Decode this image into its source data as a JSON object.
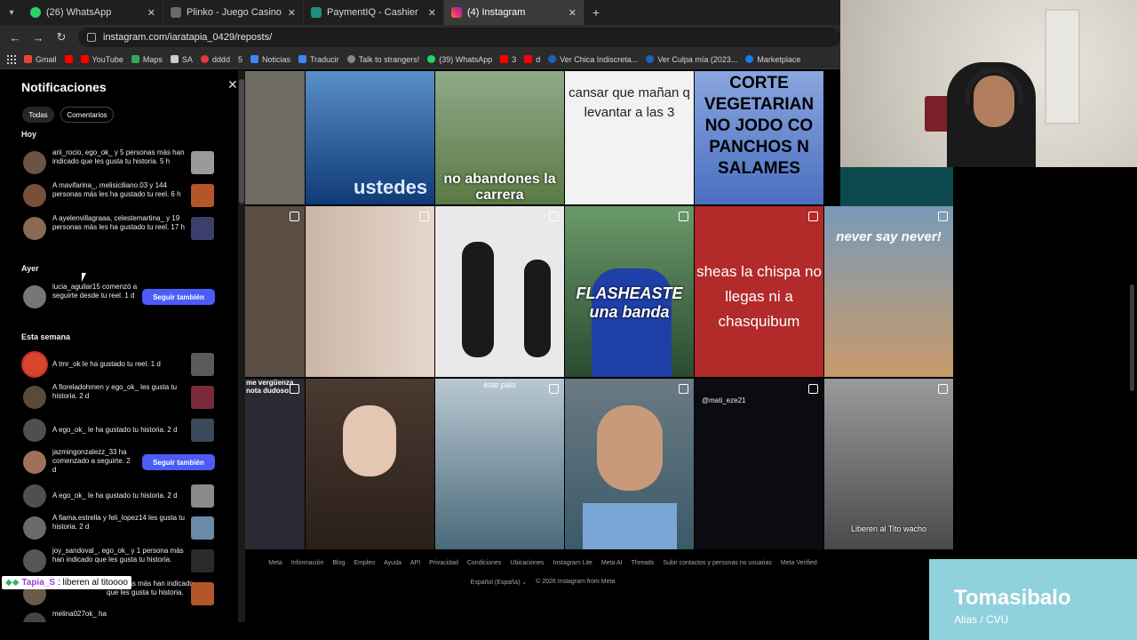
{
  "browser": {
    "tabs": [
      {
        "label": "(26) WhatsApp",
        "icon": "whatsapp-icon",
        "color": "#25d366",
        "active": false
      },
      {
        "label": "Plinko - Juego Casino Online St",
        "icon": "casino-icon",
        "color": "#6a6a6a",
        "active": false
      },
      {
        "label": "PaymentIQ - Cashier",
        "icon": "payment-icon",
        "color": "#1e8f7e",
        "active": false
      },
      {
        "label": "(4) Instagram",
        "icon": "instagram-icon",
        "color": "#e1306c",
        "active": true
      }
    ],
    "url": "instagram.com/iaratapia_0429/reposts/",
    "bookmarks": [
      {
        "label": "Gmail",
        "color": "#ea4335"
      },
      {
        "label": "",
        "color": "#ff0000"
      },
      {
        "label": "YouTube",
        "color": "#ff0000"
      },
      {
        "label": "Maps",
        "color": "#34a853"
      },
      {
        "label": "SA",
        "color": "#ffffff"
      },
      {
        "label": "dddd",
        "color": "#e53935"
      },
      {
        "label": "5",
        "color": "#2b2b2b"
      },
      {
        "label": "Noticias",
        "color": "#4285f4"
      },
      {
        "label": "Traducir",
        "color": "#4285f4"
      },
      {
        "label": "Talk to strangers!",
        "color": "#888888"
      },
      {
        "label": "(39) WhatsApp",
        "color": "#25d366"
      },
      {
        "label": "3",
        "color": "#ff0000"
      },
      {
        "label": "d",
        "color": "#ff0000"
      },
      {
        "label": "Ver Chica Indiscreta...",
        "color": "#1565c0"
      },
      {
        "label": "Ver Culpa mía (2023...",
        "color": "#1565c0"
      },
      {
        "label": "Marketplace",
        "color": "#1877f2"
      }
    ]
  },
  "notifications": {
    "title": "Notificaciones",
    "filters": [
      "Todas",
      "Comentarios"
    ],
    "sections": {
      "hoy": "Hoy",
      "ayer": "Ayer",
      "semana": "Esta semana"
    },
    "today": [
      {
        "text": "arii_rocio, ego_ok_ y 5 personas más han indicado que les gusta tu historia. 5 h",
        "avatar": "#6b5443",
        "thumb": "#9a9a9a"
      },
      {
        "text": "A mavifarina_, melisiciliano.03 y 144 personas más les ha gustado tu reel. 6 h",
        "avatar": "#7a4f3a",
        "thumb": "#b3562a"
      },
      {
        "text": "A ayelenvillagraaa, celestemartina_ y 19 personas más les ha gustado tu reel. 17 h",
        "avatar": "#8a6a55",
        "thumb": "#3b3f6b"
      }
    ],
    "yesterday": [
      {
        "text": "lucia_aguilar15 comenzó a seguirte desde tu reel. 1 d",
        "avatar": "#777777",
        "button": "Seguir también"
      }
    ],
    "week": [
      {
        "text": "A tmr_ok le ha gustado tu reel. 1 d",
        "avatar": "#d8452b",
        "thumb": "#5a5a5a",
        "ring": true
      },
      {
        "text": "A fioreladohmen y ego_ok_ les gusta tu historia. 2 d",
        "avatar": "#5a4a3a",
        "thumb": "#7a2a3a"
      },
      {
        "text": "A ego_ok_ le ha gustado tu historia. 2 d",
        "avatar": "#4f4f4f",
        "thumb": "#3a4a5a"
      },
      {
        "text": "jazmingonzalezz_33 ha comenzado a seguirte. 2 d",
        "avatar": "#a0705a",
        "button": "Seguir también"
      },
      {
        "text": "A ego_ok_ le ha gustado tu historia. 2 d",
        "avatar": "#4f4f4f",
        "thumb": "#8a8a8a"
      },
      {
        "text": "A fiama.estrella y feli_lopez14 les gusta tu historia. 2 d",
        "avatar": "#6a6a6a",
        "thumb": "#6a8aa8"
      },
      {
        "text": "joy_sandoval_, ego_ok_ y 1 persona más han indicado que les gusta tu historia.",
        "avatar": "#555555",
        "thumb": "#2a2a2a"
      },
      {
        "text": "personas más han indicado que les gusta tu historia.",
        "avatar": "#6a5a4a",
        "thumb": "#b3562a"
      },
      {
        "text": "melina027ok_ ha",
        "avatar": "#444444",
        "thumb": "#333333"
      }
    ]
  },
  "chat_overlay": {
    "user": "Tapia_S",
    "message": ": liberen al titoooo"
  },
  "grid": {
    "cells": [
      {
        "caption": "",
        "bg": "#6e6b63"
      },
      {
        "caption": "ustedes",
        "bg": "#1d4d8f"
      },
      {
        "caption": "no abandones la carrera",
        "bg": "#6e8a55"
      },
      {
        "caption": "cansar que mañan q levantar a las 3",
        "bg": "#f2f2f2"
      },
      {
        "caption": "CORTE VEGETARIAN NO JODO CO PANCHOS N SALAMES",
        "bg": "#6b8fd6"
      },
      {
        "caption": "",
        "bg": "#5a4d44"
      },
      {
        "caption": "",
        "bg": "#d8c9bd"
      },
      {
        "caption": "",
        "bg": "#e9e9e9"
      },
      {
        "caption": "FLASHEASTE una banda",
        "bg": "#3a6a48"
      },
      {
        "caption": "sheas la chispa no llegas ni a chasquibum",
        "bg": "#b22a2a"
      },
      {
        "caption": "never say never!",
        "bg": "#a88868"
      },
      {
        "caption": "me vergüenza nota dudoso:",
        "bg": "#2a2a33"
      },
      {
        "caption": "",
        "bg": "#3a2e28"
      },
      {
        "caption": "este país",
        "bg": "#6a8a9a"
      },
      {
        "caption": "",
        "bg": "#5a6a72"
      },
      {
        "caption": "@mati_eze21",
        "bg": "#0b0b12"
      },
      {
        "caption": "Liberen al Tito wacho",
        "bg": "#6a6a6a"
      }
    ]
  },
  "footer": {
    "links": [
      "Meta",
      "Información",
      "Blog",
      "Empleo",
      "Ayuda",
      "API",
      "Privacidad",
      "Condiciones",
      "Ubicaciones",
      "Instagram Lite",
      "Meta AI",
      "Threads",
      "Subir contactos y personas no usuarias",
      "Meta Verified"
    ],
    "language": "Español (España)",
    "copyright": "© 2026 Instagram from Meta"
  },
  "alias_card": {
    "name": "Tomasibalo",
    "label": "Alias / CVU"
  }
}
